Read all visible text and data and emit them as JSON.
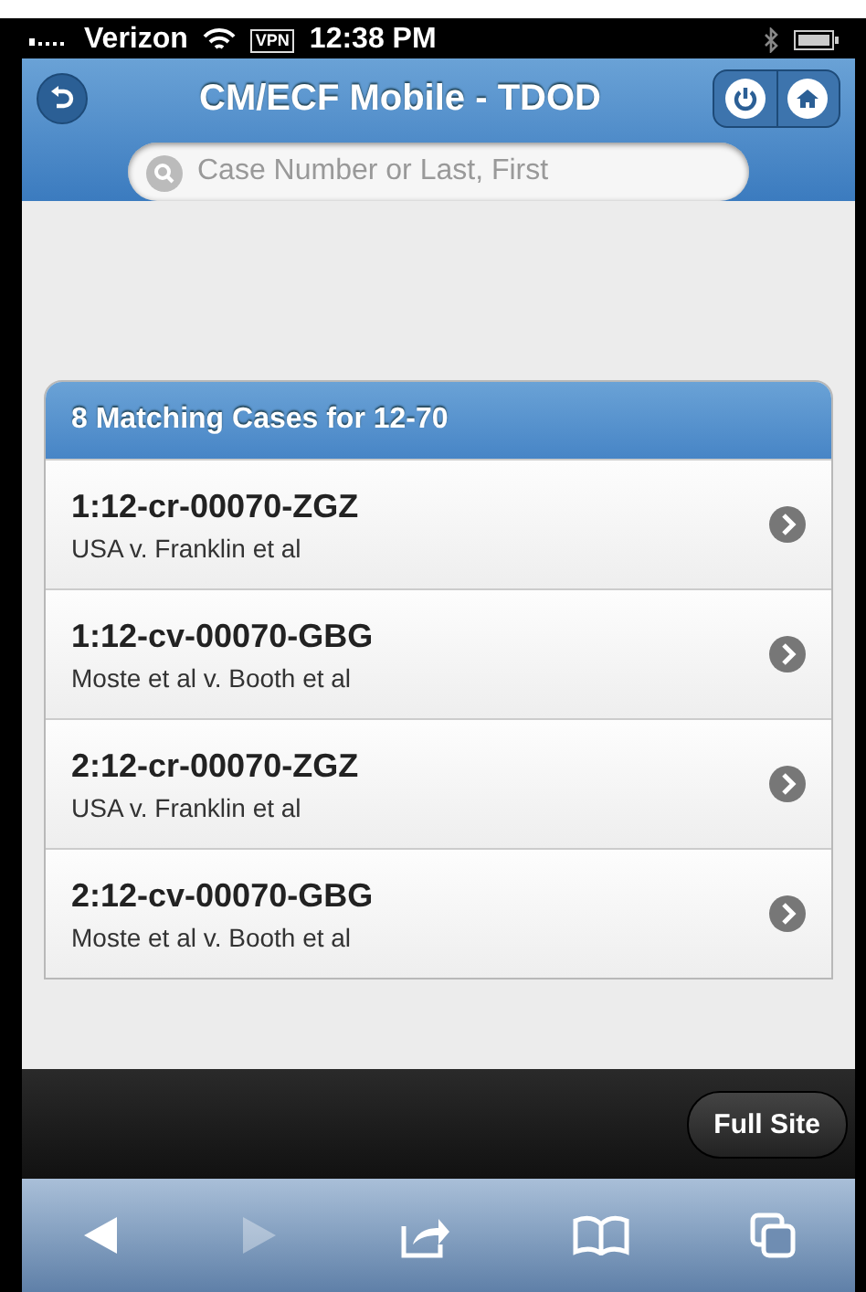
{
  "status_bar": {
    "carrier": "Verizon",
    "vpn": "VPN",
    "time": "12:38 PM"
  },
  "header": {
    "title": "CM/ECF Mobile - TDOD"
  },
  "search": {
    "placeholder": "Case Number or Last, First"
  },
  "results": {
    "heading": "8 Matching Cases for 12-70",
    "cases": [
      {
        "number": "1:12-cr-00070-ZGZ",
        "parties": "USA v. Franklin et al"
      },
      {
        "number": "1:12-cv-00070-GBG",
        "parties": "Moste et al v. Booth et al"
      },
      {
        "number": "2:12-cr-00070-ZGZ",
        "parties": "USA v. Franklin et al"
      },
      {
        "number": "2:12-cv-00070-GBG",
        "parties": "Moste et al v. Booth et al"
      }
    ]
  },
  "footer": {
    "button": "Full Site"
  },
  "toolbar": [
    {
      "kind": "back",
      "disabled": false
    },
    {
      "kind": "forward",
      "disabled": true
    },
    {
      "kind": "share",
      "disabled": false
    },
    {
      "kind": "bookmarks",
      "disabled": false
    },
    {
      "kind": "tabs",
      "disabled": false
    }
  ]
}
